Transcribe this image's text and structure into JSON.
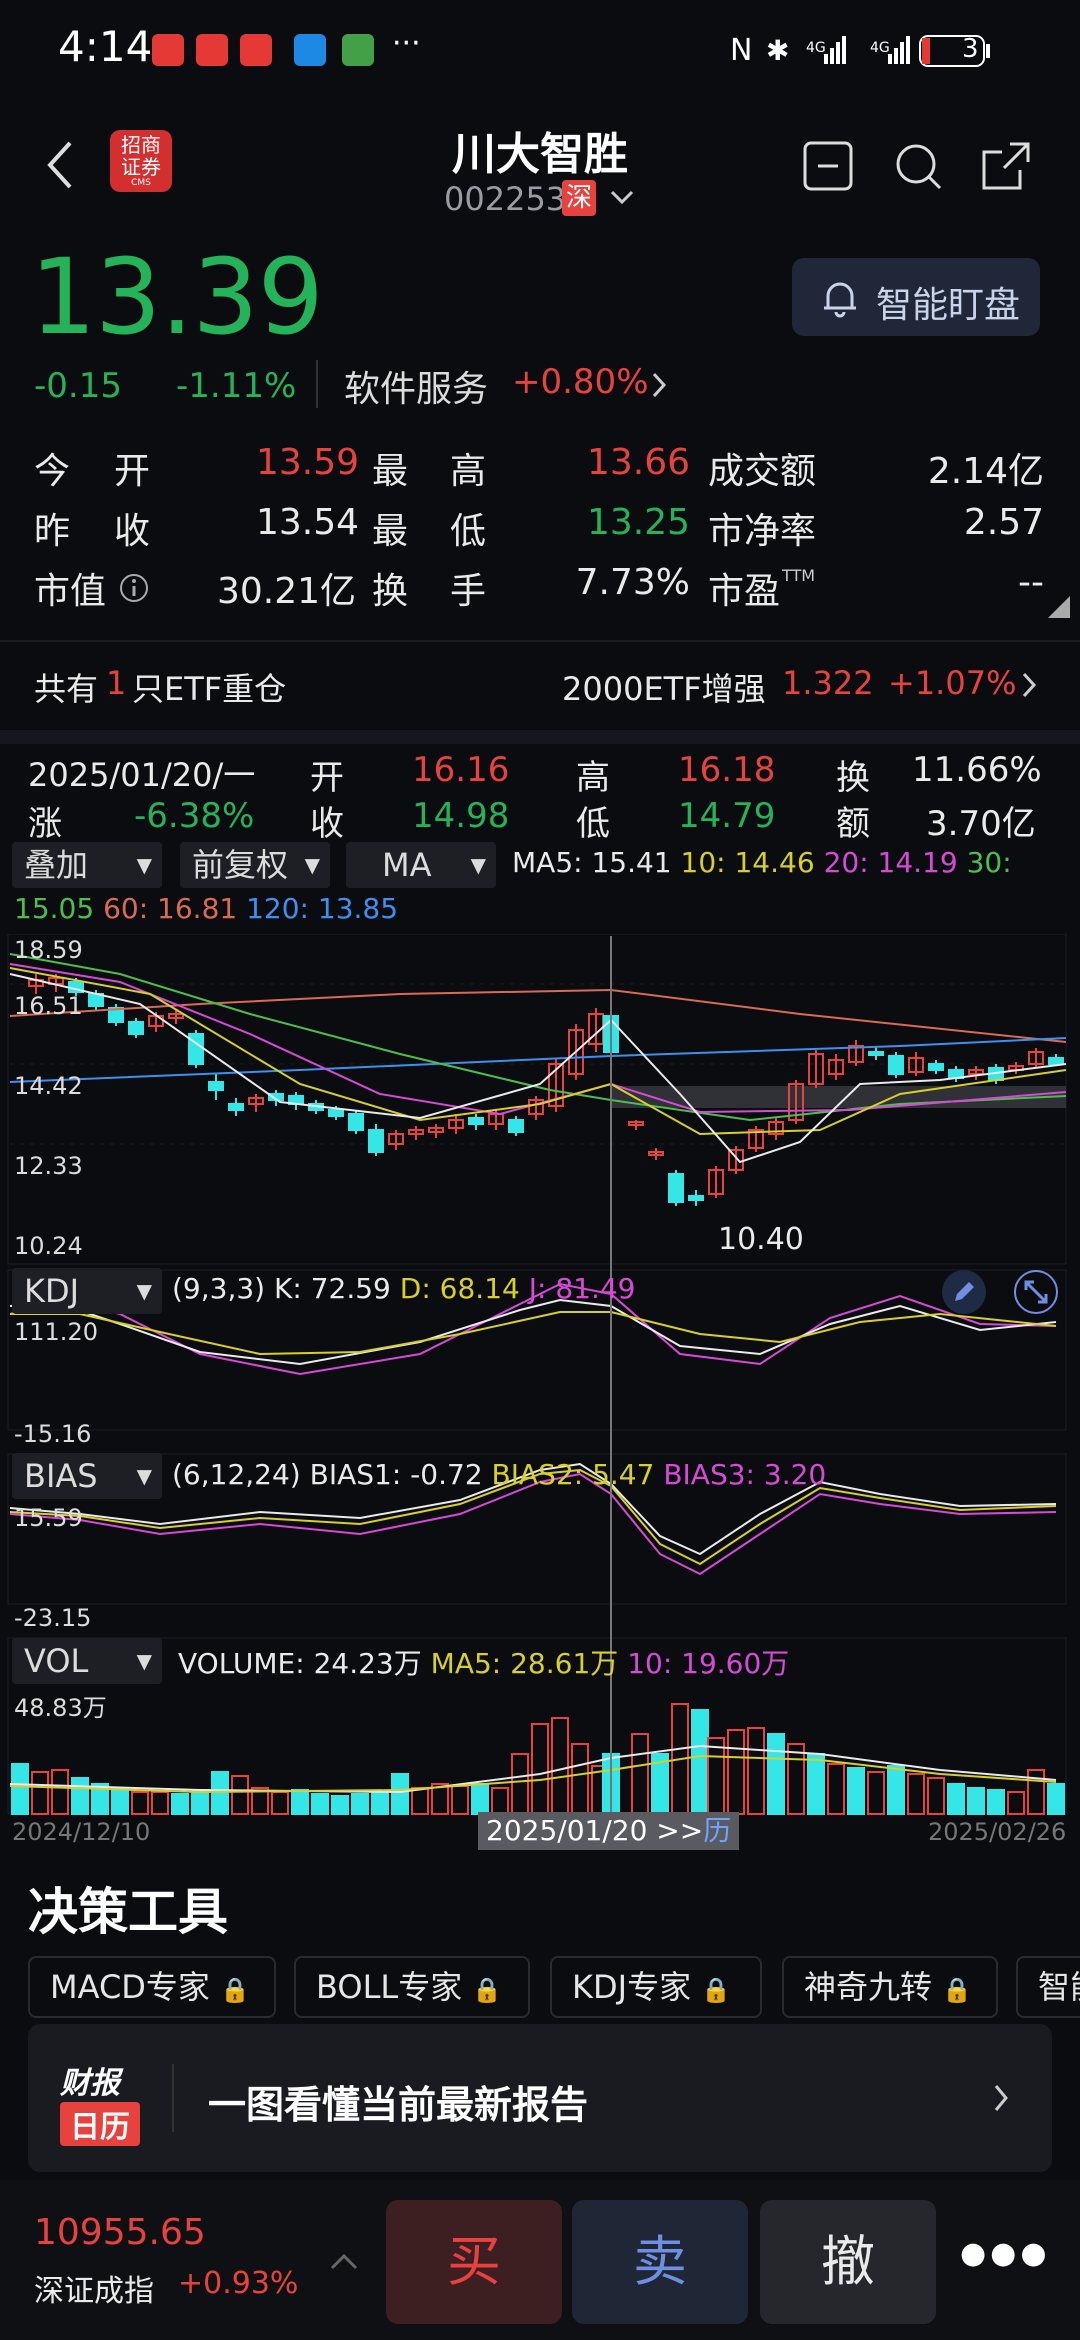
{
  "status_bar": {
    "time": "4:14",
    "more": "···",
    "battery": "3"
  },
  "header": {
    "name": "川大智胜",
    "code": "002253",
    "market": "深",
    "logo_line1": "招商",
    "logo_line2": "证券",
    "logo_sub": "CMS"
  },
  "quote": {
    "price": "13.39",
    "change": "-0.15",
    "change_pct": "-1.11%",
    "sector": "软件服务",
    "sector_pct": "+0.80%",
    "watch_label": "智能盯盘"
  },
  "stats": [
    {
      "l1": "今",
      "l2": "开",
      "v1": "13.59",
      "m1": "最",
      "m2": "高",
      "v2": "13.66",
      "r": "成交额",
      "v3": "2.14亿"
    },
    {
      "l1": "昨",
      "l2": "收",
      "v1": "13.54",
      "m1": "最",
      "m2": "低",
      "v2": "13.25",
      "r": "市净率",
      "v3": "2.57"
    },
    {
      "l1": "市值",
      "l2": "",
      "v1": "30.21亿",
      "m1": "换",
      "m2": "手",
      "v2": "7.73%",
      "r": "市盈",
      "v3": "--"
    }
  ],
  "etf": {
    "prefix": "共有",
    "count": "1",
    "suffix": "只ETF重仓",
    "name": "2000ETF增强",
    "price": "1.322",
    "pct": "+1.07%"
  },
  "chart_info": {
    "date": "2025/01/20/一",
    "open_label": "开",
    "open": "16.16",
    "high_label": "高",
    "high": "16.18",
    "turn_label": "换",
    "turn": "11.66%",
    "chg_label": "涨",
    "chg": "-6.38%",
    "close_label": "收",
    "close": "14.98",
    "low_label": "低",
    "low": "14.79",
    "amt_label": "额",
    "amt": "3.70亿"
  },
  "controls": {
    "overlay": "叠加",
    "adjust": "前复权",
    "indicator": "MA"
  },
  "ma": {
    "ma5": "MA5: 15.41",
    "ma10": "10: 14.46",
    "ma20": "20: 14.19",
    "ma30": "30:",
    "ma30v": "15.05",
    "ma60": "60: 16.81",
    "ma120": "120: 13.85"
  },
  "kline_axis": [
    "18.59",
    "16.51",
    "14.42",
    "12.33",
    "10.24"
  ],
  "kline_low_label": "10.40",
  "kdj": {
    "name": "KDJ",
    "params": "(9,3,3)",
    "k": "K: 72.59",
    "d": "D: 68.14",
    "j": "J: 81.49",
    "max": "111.20",
    "min": "-15.16"
  },
  "bias": {
    "name": "BIAS",
    "params": "(6,12,24)",
    "b1": "BIAS1: -0.72",
    "b2": "BIAS2: 5.47",
    "b3": "BIAS3: 3.20",
    "max": "15.59",
    "min": "-23.15"
  },
  "vol": {
    "name": "VOL",
    "volume": "VOLUME: 24.23万",
    "ma5": "MA5: 28.61万",
    "ma10": "10: 19.60万",
    "max": "48.83万"
  },
  "dates": {
    "start": "2024/12/10",
    "cursor": "2025/01/20 >>",
    "cursor_hist": "历",
    "end": "2025/02/26"
  },
  "tools": {
    "title": "决策工具",
    "items": [
      "MACD专家",
      "BOLL专家",
      "KDJ专家",
      "神奇九转",
      "智能"
    ]
  },
  "banner": {
    "logo1": "财报",
    "logo2": "日历",
    "text": "一图看懂当前最新报告"
  },
  "bottom": {
    "index_value": "10955.65",
    "index_name": "深证成指",
    "index_pct": "+0.93%",
    "buy": "买",
    "sell": "卖",
    "cancel": "撤",
    "more": "●●●"
  },
  "colors": {
    "up": "#e8423f",
    "down": "#25b35a",
    "ma5": "#eaeaea",
    "ma10": "#d7cf2a",
    "ma20": "#d64ad6",
    "ma30": "#4cbe4f",
    "ma60": "#d96b55",
    "ma120": "#3d8ff0",
    "vol_up": "#e8423f",
    "vol_down": "#35e6e6"
  }
}
